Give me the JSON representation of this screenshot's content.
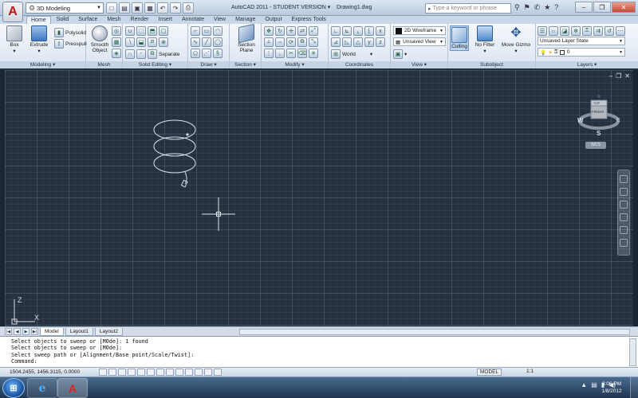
{
  "titlebar": {
    "workspace": "3D Modeling",
    "title": "AutoCAD 2011 - STUDENT VERSION",
    "drawing": "Drawing1.dwg",
    "search_placeholder": "Type a keyword or phrase"
  },
  "ribbon_tabs": [
    "Home",
    "Solid",
    "Surface",
    "Mesh",
    "Render",
    "Insert",
    "Annotate",
    "View",
    "Manage",
    "Output",
    "Express Tools"
  ],
  "panels": {
    "modeling": {
      "title": "Modeling ▾",
      "box": "Box",
      "extrude": "Extrude",
      "polysolid": "Polysolid",
      "presspull": "Presspull"
    },
    "mesh": {
      "title": "Mesh",
      "smooth": "Smooth",
      "object": "Object"
    },
    "solid_editing": {
      "title": "Solid Editing ▾",
      "separate": "Separate"
    },
    "draw": {
      "title": "Draw ▾"
    },
    "section": {
      "title": "Section ▾",
      "section": "Section",
      "plane": "Plane"
    },
    "modify": {
      "title": "Modify ▾"
    },
    "coordinates": {
      "title": "Coordinates",
      "world": "World"
    },
    "view": {
      "title": "View ▾",
      "visual_style": "2D Wireframe",
      "saved_view": "Unsaved View"
    },
    "subobject": {
      "title": "Subobject",
      "culling": "Culling",
      "no_filter": "No Filter",
      "move_gizmo": "Move Gizmo"
    },
    "layers": {
      "title": "Layers ▾",
      "layer_state": "Unsaved Layer State",
      "current_layer": "0"
    }
  },
  "viewcube": {
    "top": "TOP",
    "front": "FRONT",
    "north": "N",
    "south": "S",
    "west": "W",
    "east": "E",
    "wcs": "WCS"
  },
  "ucs": {
    "y_label": "Z",
    "x_label": "X"
  },
  "layout_tabs": [
    "Model",
    "Layout1",
    "Layout2"
  ],
  "command_history": [
    "Select objects to sweep or [MOde]: 1 found",
    "Select objects to sweep or [MOde]:",
    "Select sweep path or [Alignment/Base point/Scale/Twist]:",
    "Command:"
  ],
  "status": {
    "coordinates": "1504.2455, 1456.3115, 0.0000",
    "model": "MODEL",
    "scale": "1:1"
  },
  "taskbar": {
    "time": "3:06 PM",
    "date": "1/8/2012"
  },
  "colors": {
    "viewport_bg": "#263140",
    "geometry": "#d9dfe6",
    "accent_logo": "#c0161b"
  }
}
